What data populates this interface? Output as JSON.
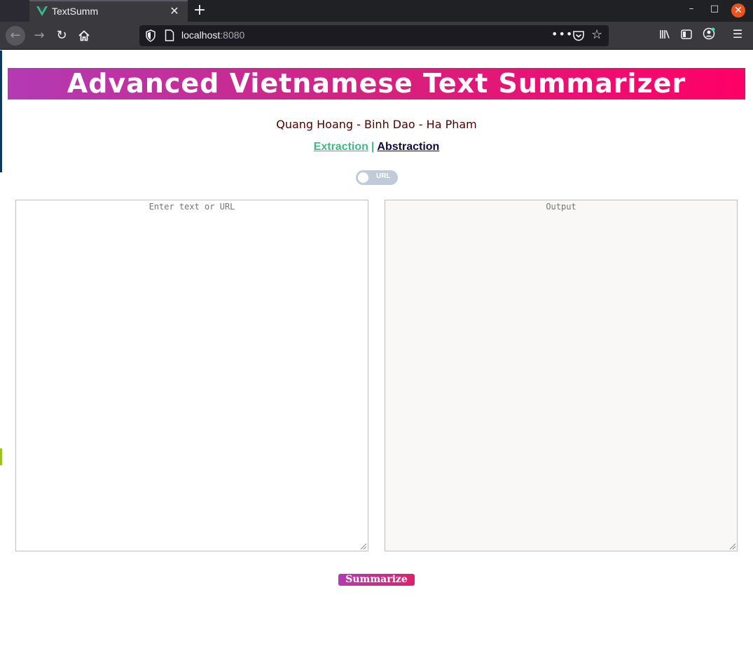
{
  "browser": {
    "tab_title": "TextSumm",
    "tab_close": "✕",
    "new_tab": "+",
    "url_host": "localhost",
    "url_port": ":8080",
    "page_actions": "•••",
    "minimize": "–",
    "maximize": "□",
    "close": "✕",
    "accent_color": "#e95420"
  },
  "app": {
    "title": "Advanced Vietnamese Text Summarizer",
    "authors": "Quang Hoang - Binh Dao - Ha Pham",
    "modes": {
      "extraction": "Extraction",
      "separator": "|",
      "abstraction": "Abstraction"
    },
    "toggle": {
      "label": "URL",
      "checked": false
    },
    "input": {
      "placeholder": "Enter text or URL",
      "value": ""
    },
    "output": {
      "placeholder": "Output",
      "value": ""
    },
    "summarize_label": "Summarize",
    "colors": {
      "banner_start": "#b33ab4",
      "banner_end": "#ff0066",
      "extraction_link": "#42b983",
      "abstraction_link": "#0f0a3c",
      "authors_text": "#4b0000"
    }
  }
}
